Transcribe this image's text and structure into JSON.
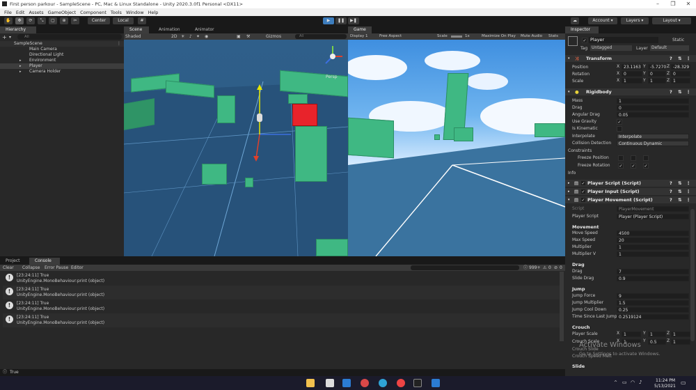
{
  "window": {
    "title": "First person parkour - SampleScene - PC, Mac & Linux Standalone - Unity 2020.3.0f1 Personal <DX11>"
  },
  "menu": [
    "File",
    "Edit",
    "Assets",
    "GameObject",
    "Component",
    "Tools",
    "Window",
    "Help"
  ],
  "toolbar": {
    "center_label": "Center",
    "local_label": "Local",
    "account_label": "Account",
    "layers_label": "Layers",
    "layout_label": "Layout"
  },
  "hierarchy": {
    "tab": "Hierarchy",
    "search_placeholder": "All",
    "scene": "SampleScene",
    "items": [
      "Main Camera",
      "Directional Light",
      "Environment",
      "Player",
      "Camera Holder"
    ]
  },
  "scene_view": {
    "tabs": [
      "Scene",
      "Animation",
      "Animator"
    ],
    "shading": "Shaded",
    "mode_2d": "2D",
    "gizmos": "Gizmos",
    "search_placeholder": "All",
    "persp_label": "Persp"
  },
  "game_view": {
    "tab": "Game",
    "display": "Display 1",
    "aspect": "Free Aspect",
    "scale_label": "Scale",
    "scale_value": "1x",
    "maximize": "Maximize On Play",
    "mute": "Mute Audio",
    "stats": "Stats"
  },
  "inspector": {
    "tab": "Inspector",
    "object_name": "Player",
    "static_label": "Static",
    "tag_label": "Tag",
    "tag_value": "Untagged",
    "layer_label": "Layer",
    "layer_value": "Default",
    "transform": {
      "title": "Transform",
      "position_label": "Position",
      "position": [
        "23.1163",
        "-5.7270",
        "-28.329"
      ],
      "rotation_label": "Rotation",
      "rotation": [
        "0",
        "0",
        "0"
      ],
      "scale_label": "Scale",
      "scale": [
        "1",
        "1",
        "1"
      ]
    },
    "rigidbody": {
      "title": "Rigidbody",
      "mass_label": "Mass",
      "mass": "1",
      "drag_label": "Drag",
      "drag": "0",
      "angular_drag_label": "Angular Drag",
      "angular_drag": "0.05",
      "use_gravity_label": "Use Gravity",
      "is_kinematic_label": "Is Kinematic",
      "interpolate_label": "Interpolate",
      "interpolate": "Interpolate",
      "collision_label": "Collision Detection",
      "collision": "Continuous Dynamic",
      "constraints_label": "Constraints",
      "freeze_pos_label": "Freeze Position",
      "freeze_rot_label": "Freeze Rotation",
      "info_label": "Info"
    },
    "components": [
      "Player Script (Script)",
      "Player Input (Script)",
      "Player Movement (Script)"
    ],
    "movement": {
      "script_label": "Script",
      "script_value": "PlayerMovement",
      "player_script_label": "Player Script",
      "player_script_value": "Player (Player Script)",
      "movement_header": "Movement",
      "move_speed_label": "Move Speed",
      "move_speed": "4500",
      "max_speed_label": "Max Speed",
      "max_speed": "20",
      "multiplier_label": "Multiplier",
      "multiplier": "1",
      "multiplier_v_label": "Multiplier V",
      "multiplier_v": "1",
      "drag_header": "Drag",
      "drag_label": "Drag",
      "drag": "7",
      "slide_drag_label": "Slide Drag",
      "slide_drag": "0.9",
      "jump_header": "Jump",
      "jump_force_label": "Jump Force",
      "jump_force": "9",
      "jump_mult_label": "Jump Multiplier",
      "jump_mult": "1.5",
      "jump_cool_label": "Jump Cool Down",
      "jump_cool": "0.25",
      "time_since_label": "Time Since Last Jump",
      "time_since": "0.2519124",
      "crouch_header": "Crouch",
      "player_scale_label": "Player Scale",
      "player_scale": [
        "1",
        "1",
        "1"
      ],
      "crouch_scale_label": "Crouch Scale",
      "crouch_scale": [
        "1",
        "0.5",
        "1"
      ],
      "crouch_lbl3": "Crouch Slide",
      "crouch_lbl4": "Crouch Speed Mult",
      "slide_header": "Slide"
    },
    "watermark_1": "Activate Windows",
    "watermark_2": "Go to Settings to activate Windows."
  },
  "console": {
    "tabs": [
      "Project",
      "Console"
    ],
    "clear": "Clear",
    "collapse": "Collapse",
    "error_pause": "Error Pause",
    "editor": "Editor",
    "count_log": "999+",
    "count_warn": "0",
    "count_err": "0",
    "logs": [
      {
        "time": "[23:24:11] True",
        "detail": "UnityEngine.MonoBehaviour:print (object)"
      },
      {
        "time": "[23:24:11] True",
        "detail": "UnityEngine.MonoBehaviour:print (object)"
      },
      {
        "time": "[23:24:11] True",
        "detail": "UnityEngine.MonoBehaviour:print (object)"
      },
      {
        "time": "[23:24:11] True",
        "detail": "UnityEngine.MonoBehaviour:print (object)"
      }
    ]
  },
  "status_bar": {
    "text": "True"
  },
  "taskbar": {
    "time": "11:24 PM",
    "date": "5/13/2021"
  },
  "colors": {
    "accent": "#3d7dbd",
    "cube": "#3fb883",
    "selected_red": "#e8232b",
    "sky": "#4a9ee8"
  }
}
